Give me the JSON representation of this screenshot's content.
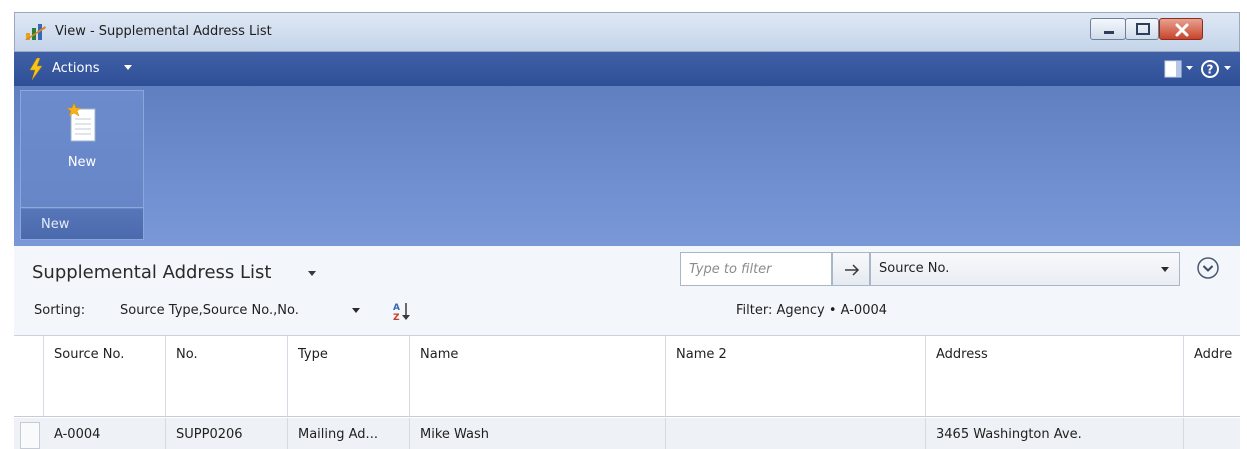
{
  "window": {
    "title": "View - Supplemental Address List",
    "buttons": [
      "minimize",
      "maximize",
      "close"
    ]
  },
  "actions_bar": {
    "label": "Actions"
  },
  "ribbon": {
    "groups": [
      {
        "buttons": [
          {
            "label": "New",
            "icon": "new-document-icon"
          }
        ],
        "label": "New"
      }
    ]
  },
  "list": {
    "title": "Supplemental Address List",
    "filter": {
      "placeholder": "Type to filter",
      "field": "Source No."
    },
    "sorting": {
      "label": "Sorting:",
      "value": "Source Type,Source No.,No."
    },
    "applied_filter": "Filter: Agency • A-0004"
  },
  "table": {
    "columns": [
      "Source No.",
      "No.",
      "Type",
      "Name",
      "Name 2",
      "Address",
      "Addre"
    ],
    "rows": [
      [
        "A-0004",
        "SUPP0206",
        "Mailing Ad...",
        "Mike Wash",
        "",
        "3465 Washington Ave.",
        ""
      ]
    ]
  },
  "colors": {
    "actions_bar": "#2f4f96",
    "ribbon": "#6f8fd0",
    "close_button": "#c8442a"
  }
}
